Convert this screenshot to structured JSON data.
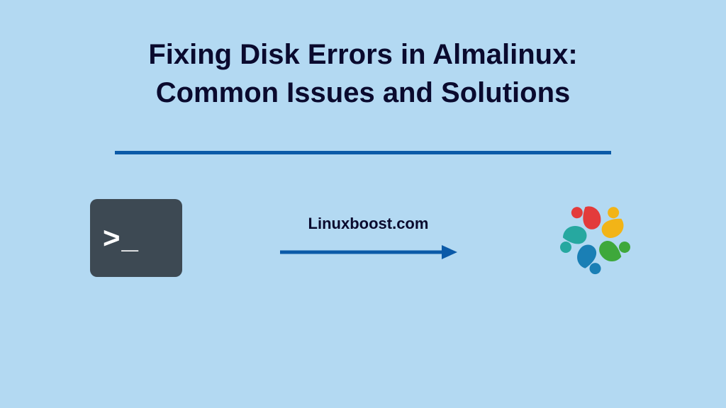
{
  "title_line1": "Fixing Disk Errors in Almalinux:",
  "title_line2": "Common Issues and Solutions",
  "brand": "Linuxboost.com",
  "terminal_prompt": ">_",
  "colors": {
    "background": "#b3d9f2",
    "title_text": "#0a0a2e",
    "divider": "#0b5aa8",
    "arrow": "#0b5aa8",
    "terminal_bg": "#3d4953",
    "logo_red": "#e33b3b",
    "logo_yellow": "#f2b417",
    "logo_green": "#3ea83b",
    "logo_blue": "#1a7fb5",
    "logo_cyan": "#26a8a0"
  }
}
